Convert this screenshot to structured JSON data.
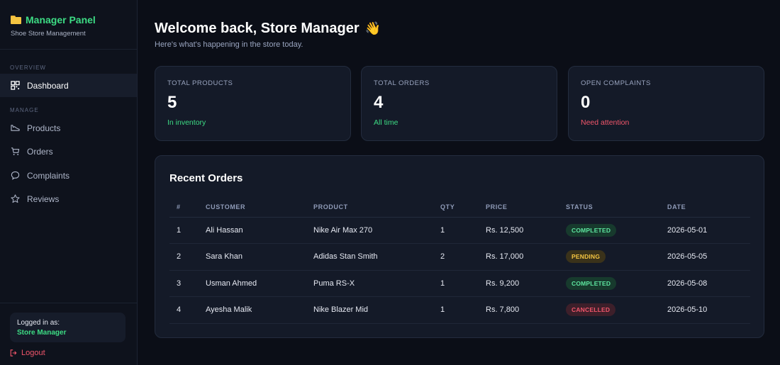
{
  "sidebar": {
    "brand_title": "Manager Panel",
    "brand_subtitle": "Shoe Store Management",
    "overview_label": "OVERVIEW",
    "manage_label": "MANAGE",
    "items": [
      {
        "label": "Dashboard",
        "icon": "grid-icon",
        "active": true
      },
      {
        "label": "Products",
        "icon": "shoe-icon",
        "active": false
      },
      {
        "label": "Orders",
        "icon": "cart-icon",
        "active": false
      },
      {
        "label": "Complaints",
        "icon": "chat-icon",
        "active": false
      },
      {
        "label": "Reviews",
        "icon": "star-icon",
        "active": false
      }
    ],
    "logged_in_label": "Logged in as:",
    "logged_in_user": "Store Manager",
    "logout_label": "Logout"
  },
  "header": {
    "welcome": "Welcome back, Store Manager",
    "emoji": "👋",
    "subtitle": "Here's what's happening in the store today."
  },
  "stats": [
    {
      "label": "TOTAL PRODUCTS",
      "value": "5",
      "note": "In inventory",
      "tone": "green"
    },
    {
      "label": "TOTAL ORDERS",
      "value": "4",
      "note": "All time",
      "tone": "green"
    },
    {
      "label": "OPEN COMPLAINTS",
      "value": "0",
      "note": "Need attention",
      "tone": "red"
    }
  ],
  "orders": {
    "title": "Recent Orders",
    "columns": [
      "#",
      "CUSTOMER",
      "PRODUCT",
      "QTY",
      "PRICE",
      "STATUS",
      "DATE"
    ],
    "rows": [
      {
        "num": "1",
        "customer": "Ali Hassan",
        "product": "Nike Air Max 270",
        "qty": "1",
        "price": "Rs. 12,500",
        "status": "COMPLETED",
        "date": "2026-05-01"
      },
      {
        "num": "2",
        "customer": "Sara Khan",
        "product": "Adidas Stan Smith",
        "qty": "2",
        "price": "Rs. 17,000",
        "status": "PENDING",
        "date": "2026-05-05"
      },
      {
        "num": "3",
        "customer": "Usman Ahmed",
        "product": "Puma RS-X",
        "qty": "1",
        "price": "Rs. 9,200",
        "status": "COMPLETED",
        "date": "2026-05-08"
      },
      {
        "num": "4",
        "customer": "Ayesha Malik",
        "product": "Nike Blazer Mid",
        "qty": "1",
        "price": "Rs. 7,800",
        "status": "CANCELLED",
        "date": "2026-05-10"
      }
    ]
  },
  "colors": {
    "accent_green": "#3ddc84",
    "alert_red": "#f2566b",
    "pending_yellow": "#f5c542",
    "background": "#0b0e17"
  }
}
